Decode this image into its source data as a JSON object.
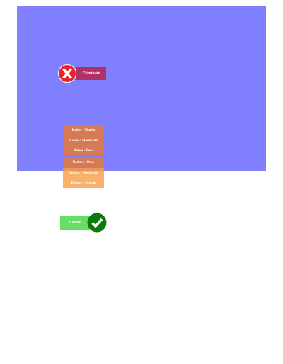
{
  "colors": {
    "panel": "#8080ff",
    "eliminate_button": "#b03068",
    "x_icon_fill": "#ee2222",
    "x_icon_ring": "#ffffff",
    "option_dark": "#d57a55",
    "option_mid": "#e69a5a",
    "option_light": "#f9b06a",
    "create_button": "#66dd66",
    "check_icon_fill": "#0a7a0a"
  },
  "eliminate": {
    "label": "Eliminate",
    "icon": "x-icon"
  },
  "options": [
    {
      "label": "Raises · Mucho"
    },
    {
      "label": "Raises · Moderado"
    },
    {
      "label": "Raises · Poco"
    },
    {
      "label": "Reduce · Poco"
    },
    {
      "label": "Reduce · Moderado"
    },
    {
      "label": "Reduce · Mucho"
    }
  ],
  "create": {
    "label": "Create",
    "icon": "check-icon"
  }
}
